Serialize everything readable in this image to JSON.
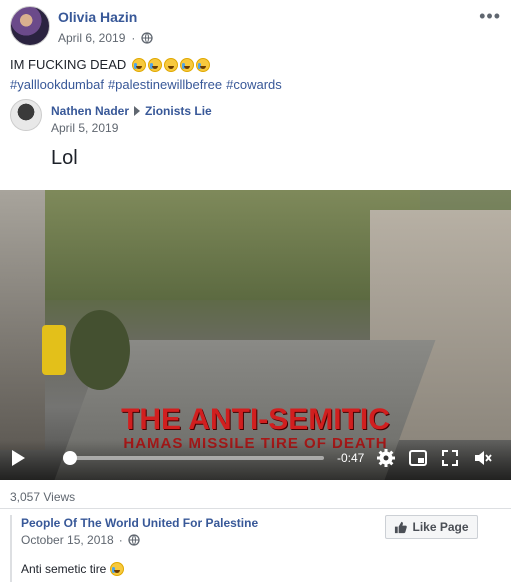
{
  "post": {
    "author": "Olivia Hazin",
    "date": "April 6, 2019",
    "privacy_icon": "globe-icon",
    "more_label": "•••",
    "text": "IM FUCKING DEAD",
    "emojis": [
      "crying-emoji",
      "crying-emoji",
      "laughing-emoji",
      "rofl-emoji",
      "rofl-emoji"
    ],
    "hashtags": [
      "#yalllookdumbaf",
      "#palestinewillbefree",
      "#cowards"
    ]
  },
  "shared_post": {
    "author": "Nathen Nader",
    "target": "Zionists Lie",
    "date": "April 5, 2019",
    "text": "Lol"
  },
  "video": {
    "title_overlay": "THE ANTI-SEMITIC",
    "subtitle_overlay": "HAMAS MISSILE TIRE OF DEATH",
    "time_remaining": "-0:47",
    "progress_fraction": 0.02
  },
  "footer": {
    "views": "3,057 Views",
    "page_name": "People Of The World United For Palestine",
    "page_date": "October 15, 2018",
    "like_page_label": "Like Page",
    "caption": "Anti semetic tire"
  },
  "colors": {
    "link": "#385898",
    "meta": "#606770",
    "video_title": "#d11f1f"
  }
}
